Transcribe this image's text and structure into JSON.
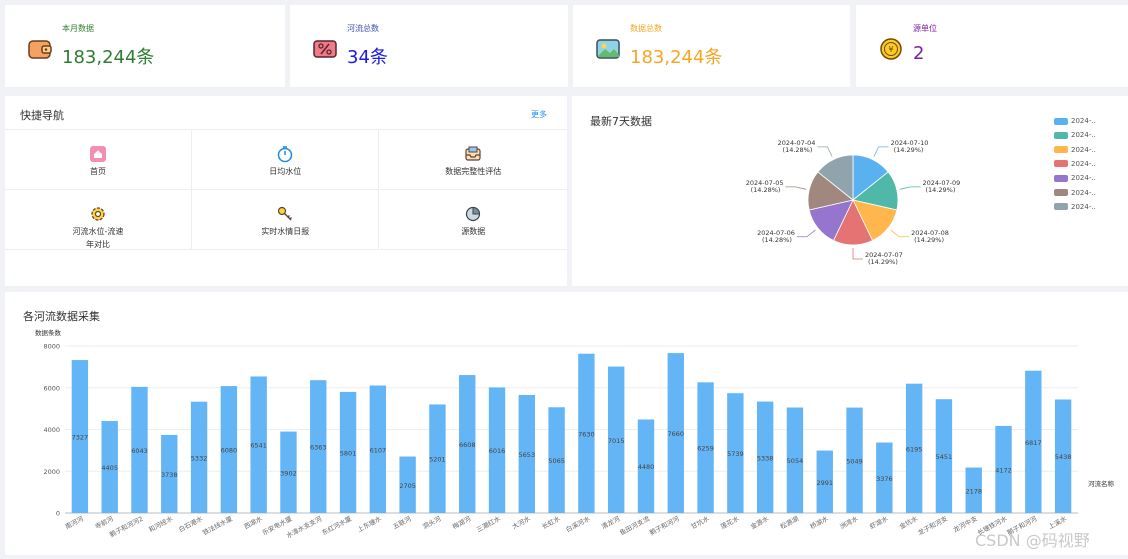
{
  "stats": [
    {
      "label": "本月数据",
      "value": "183,244条",
      "label_color": "#2e7d32",
      "value_color": "#2e7d32",
      "icon": "wallet-icon"
    },
    {
      "label": "河流总数",
      "value": "34条",
      "label_color": "#3f51b5",
      "value_color": "#1a1ae0",
      "icon": "percent-tag-icon"
    },
    {
      "label": "数据总数",
      "value": "183,244条",
      "label_color": "#f5a623",
      "value_color": "#f5a623",
      "icon": "picture-icon"
    },
    {
      "label": "源单位",
      "value": "2",
      "label_color": "#7b1fa2",
      "value_color": "#7b1fa2",
      "icon": "coin-icon"
    }
  ],
  "nav": {
    "title": "快捷导航",
    "more": "更多",
    "items": [
      {
        "label": "首页",
        "icon": "home-icon"
      },
      {
        "label": "日均水位",
        "icon": "stopwatch-icon"
      },
      {
        "label": "数据完整性评估",
        "icon": "inbox-icon"
      },
      {
        "label": "河流水位-流速",
        "label2": "年对比",
        "icon": "gear-icon"
      },
      {
        "label": "实时水情日报",
        "icon": "key-icon"
      },
      {
        "label": "源数据",
        "icon": "pie-icon"
      }
    ]
  },
  "pie": {
    "title": "最新7天数据",
    "legend": [
      "2024-..",
      "2024-..",
      "2024-..",
      "2024-..",
      "2024-..",
      "2024-..",
      "2024-.."
    ],
    "chart_data": {
      "type": "pie",
      "slices": [
        {
          "label": "2024-07-10",
          "pct": "(14.29%)",
          "value": 1,
          "color": "#5ab1ef"
        },
        {
          "label": "2024-07-09",
          "pct": "(14.29%)",
          "value": 1,
          "color": "#4fb8a8"
        },
        {
          "label": "2024-07-08",
          "pct": "(14.29%)",
          "value": 1,
          "color": "#ffb74d"
        },
        {
          "label": "2024-07-07",
          "pct": "(14.29%)",
          "value": 1,
          "color": "#e57373"
        },
        {
          "label": "2024-07-06",
          "pct": "(14.28%)",
          "value": 1,
          "color": "#9575cd"
        },
        {
          "label": "2024-07-05",
          "pct": "(14.28%)",
          "value": 1,
          "color": "#a1887f"
        },
        {
          "label": "2024-07-04",
          "pct": "(14.28%)",
          "value": 1,
          "color": "#90a4ae"
        }
      ]
    }
  },
  "bar": {
    "title": "各河流数据采集",
    "chart_data": {
      "type": "bar",
      "ylabel": "数据条数",
      "xlabel": "河流名称",
      "ylim": [
        0,
        8000
      ],
      "yticks": [
        0,
        2000,
        4000,
        6000,
        8000
      ],
      "bar_color": "#64b5f6",
      "categories": [
        "南河河",
        "寺前河",
        "鹅子和河河2",
        "和河经水",
        "白石港水",
        "铁法线水厦",
        "西湖水",
        "乐安电水厦",
        "水漳水支支河",
        "东红河水厦",
        "上东塘水",
        "五联河",
        "洞头河",
        "梅湖河",
        "三潮红水",
        "大河水",
        "长虹水",
        "白溪河水",
        "清龙河",
        "鱼田河支流",
        "鹅子和河河",
        "甘坑水",
        "莲花水",
        "金源水",
        "松源湖",
        "桥湖水",
        "洲湾水",
        "虾湖水",
        "金坑水",
        "龙子和河支",
        "龙河中支",
        "长塘铁河水",
        "鹅子和河河",
        "上溪水"
      ],
      "values": [
        7327,
        4405,
        6043,
        3738,
        5332,
        6080,
        6541,
        3902,
        6363,
        5801,
        6107,
        2705,
        5201,
        6608,
        6016,
        5653,
        5065,
        7630,
        7015,
        4480,
        7660,
        6259,
        5739,
        5338,
        5054,
        2991,
        5049,
        3376,
        6195,
        5451,
        2178,
        4172,
        6817,
        5438
      ]
    }
  },
  "watermark": "CSDN @码视野"
}
